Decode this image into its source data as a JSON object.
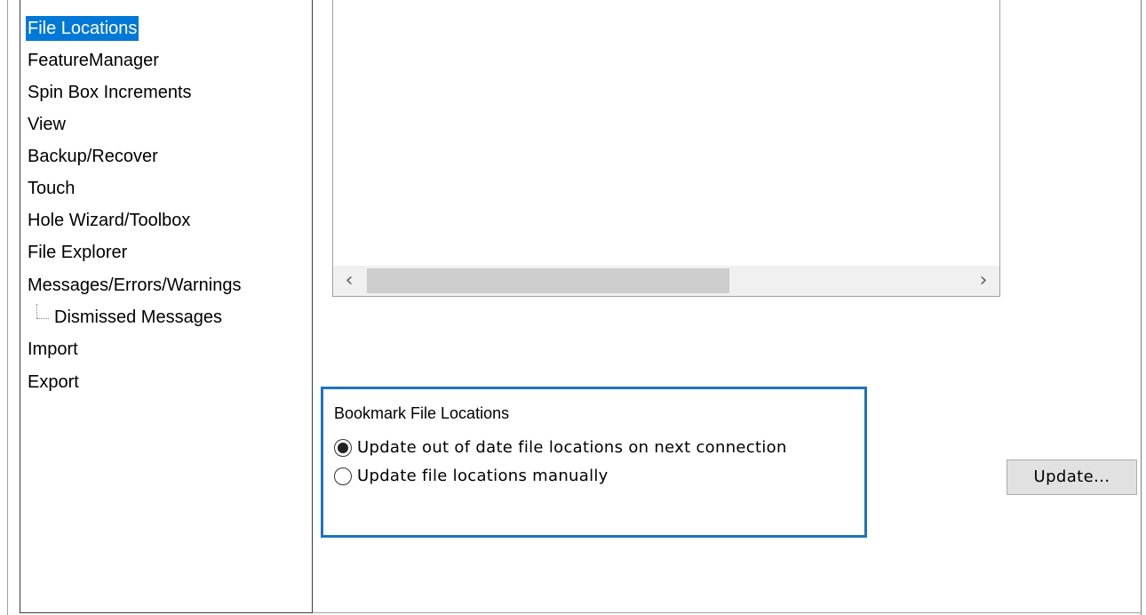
{
  "tree": {
    "items": [
      {
        "label": "File Locations",
        "selected": true
      },
      {
        "label": "FeatureManager"
      },
      {
        "label": "Spin Box Increments"
      },
      {
        "label": "View"
      },
      {
        "label": "Backup/Recover"
      },
      {
        "label": "Touch"
      },
      {
        "label": "Hole Wizard/Toolbox"
      },
      {
        "label": "File Explorer"
      },
      {
        "label": "Messages/Errors/Warnings"
      },
      {
        "label": "Dismissed Messages",
        "child": true
      },
      {
        "label": "Import"
      },
      {
        "label": "Export"
      }
    ]
  },
  "listbox": {
    "scroll_left_icon": "chevron-left",
    "scroll_right_icon": "chevron-right"
  },
  "bookmark": {
    "title": "Bookmark File Locations",
    "options": [
      {
        "label": "Update out of date file locations on next connection",
        "checked": true
      },
      {
        "label": "Update file locations manually",
        "checked": false
      }
    ]
  },
  "buttons": {
    "update_label": "Update..."
  },
  "colors": {
    "selection": "#0078d7",
    "group_border": "#1e73be"
  }
}
